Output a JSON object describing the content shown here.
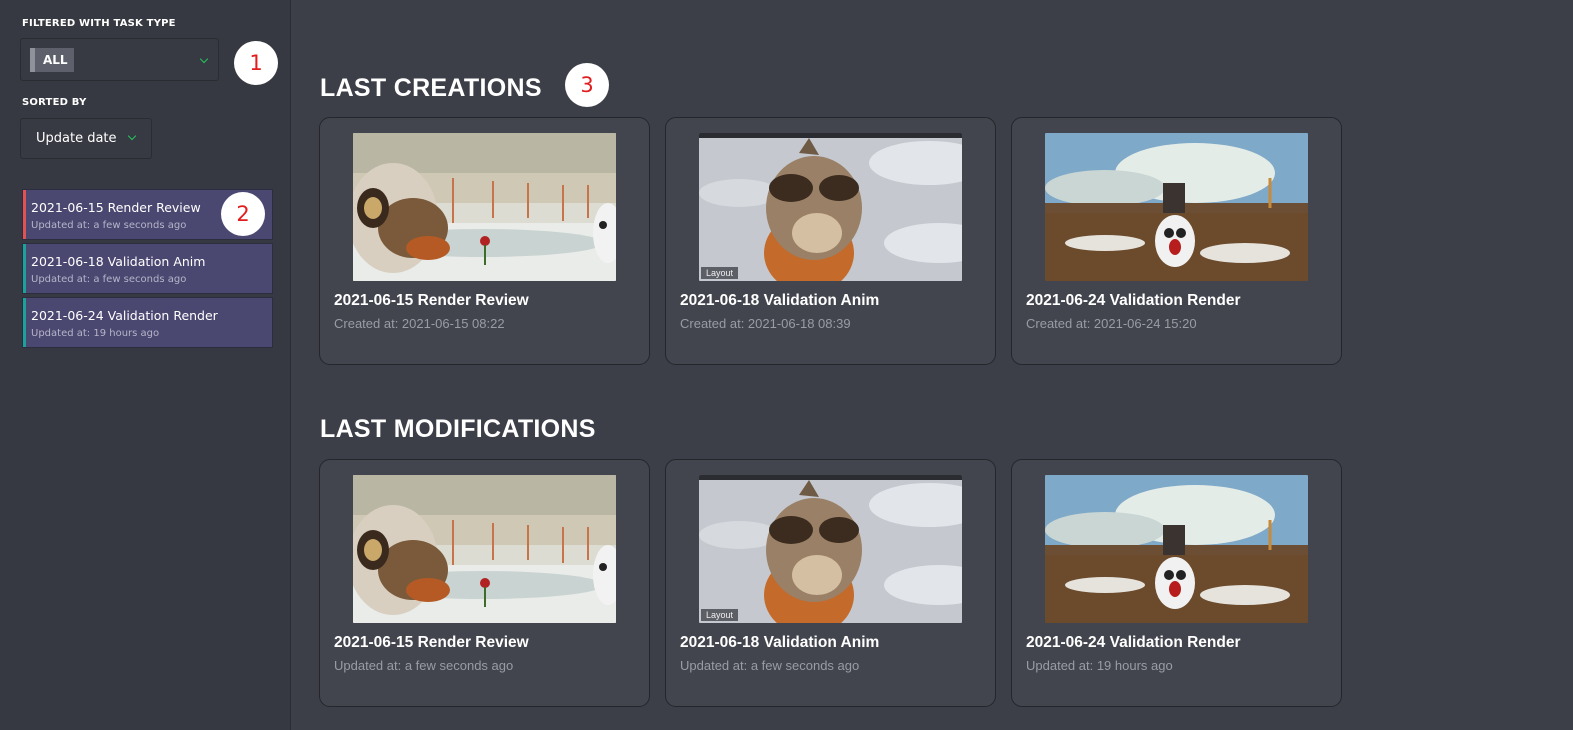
{
  "sidebar": {
    "filter_label": "FILTERED WITH TASK TYPE",
    "filter_value": "ALL",
    "sort_label": "SORTED BY",
    "sort_value": "Update date",
    "playlists": [
      {
        "title": "2021-06-15 Render Review",
        "updated": "Updated at: a few seconds ago",
        "color": "#e15353"
      },
      {
        "title": "2021-06-18 Validation Anim",
        "updated": "Updated at: a few seconds ago",
        "color": "#1aa39a"
      },
      {
        "title": "2021-06-24 Validation Render",
        "updated": "Updated at: 19 hours ago",
        "color": "#1aa39a"
      }
    ]
  },
  "callouts": [
    "1",
    "2",
    "3"
  ],
  "sections": {
    "creations": {
      "title": "LAST CREATIONS",
      "cards": [
        {
          "title": "2021-06-15 Render Review",
          "sub": "Created at: 2021-06-15 08:22",
          "thumb": "snow-creature-icon"
        },
        {
          "title": "2021-06-18 Validation Anim",
          "sub": "Created at: 2021-06-18 08:39",
          "thumb": "animal-head-icon",
          "overlay": "Layout"
        },
        {
          "title": "2021-06-24 Validation Render",
          "sub": "Created at: 2021-06-24 15:20",
          "thumb": "penguin-landscape-icon"
        }
      ]
    },
    "modifications": {
      "title": "LAST MODIFICATIONS",
      "cards": [
        {
          "title": "2021-06-15 Render Review",
          "sub": "Updated at: a few seconds ago",
          "thumb": "snow-creature-icon"
        },
        {
          "title": "2021-06-18 Validation Anim",
          "sub": "Updated at: a few seconds ago",
          "thumb": "animal-head-icon",
          "overlay": "Layout"
        },
        {
          "title": "2021-06-24 Validation Render",
          "sub": "Updated at: 19 hours ago",
          "thumb": "penguin-landscape-icon"
        }
      ]
    }
  },
  "colors": {
    "accent_green": "#22c55e",
    "callout_red": "#e11d1d",
    "playlist_bg": "#4a4771"
  }
}
